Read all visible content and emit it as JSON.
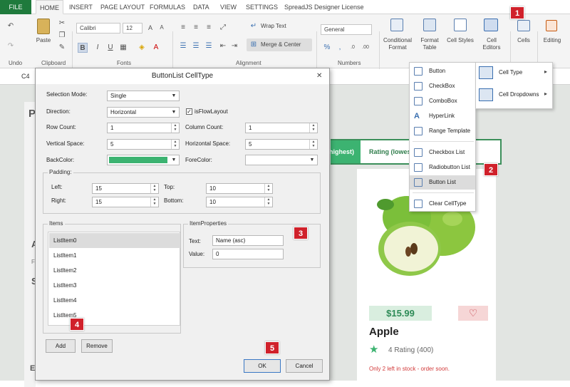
{
  "tabs": [
    "FILE",
    "HOME",
    "INSERT",
    "PAGE LAYOUT",
    "FORMULAS",
    "DATA",
    "VIEW",
    "SETTINGS",
    "SpreadJS Designer License"
  ],
  "ribbon": {
    "groups": {
      "undo": "Undo",
      "clipboard": "Clipboard",
      "fonts": "Fonts",
      "alignment": "Alignment",
      "numbers": "Numbers"
    },
    "paste": "Paste",
    "font_name": "Calibri",
    "font_size": "12",
    "wrap_text": "Wrap Text",
    "merge_center": "Merge & Center",
    "number_format": "General",
    "conditional_format": [
      "Conditional",
      "Format"
    ],
    "format_table": [
      "Format",
      "Table"
    ],
    "cell_styles": "Cell Styles",
    "cell_editors": [
      "Cell",
      "Editors"
    ],
    "cells": "Cells",
    "editing": "Editing",
    "bold": "B",
    "italic": "I",
    "underline": "U"
  },
  "formula_bar": {
    "cell_ref": "C4"
  },
  "sheet": {
    "p_letter": "P",
    "a_letter": "A",
    "f_letter": "F",
    "s_letter": "S",
    "e_letter": "E",
    "header_highest": "highest)",
    "header_rating_lowest": "Rating (lowes",
    "price": "$15.99",
    "product_name": "Apple",
    "rating": "4 Rating (400)",
    "stock": "Only 2 left in stock - order soon.",
    "star": "★",
    "heart": "♡"
  },
  "dialog": {
    "title": "ButtonList CellType",
    "close": "✕",
    "selection_mode_label": "Selection Mode:",
    "selection_mode": "Single",
    "direction_label": "Direction:",
    "direction": "Horizontal",
    "is_flow_layout": "isFlowLayout",
    "row_count_label": "Row Count:",
    "row_count": "1",
    "column_count_label": "Column Count:",
    "column_count": "1",
    "vertical_space_label": "Vertical Space:",
    "vertical_space": "5",
    "horizontal_space_label": "Horizontal Space:",
    "horizontal_space": "5",
    "back_color_label": "BackColor:",
    "back_color": "#3cb371",
    "fore_color_label": "ForeColor:",
    "padding_label": "Padding:",
    "left_label": "Left:",
    "left": "15",
    "top_label": "Top:",
    "top": "10",
    "right_label": "Right:",
    "right": "15",
    "bottom_label": "Bottom:",
    "bottom": "10",
    "items_label": "Items",
    "items": [
      "ListItem0",
      "ListItem1",
      "ListItem2",
      "ListItem3",
      "ListItem4",
      "ListItem5"
    ],
    "item_properties_label": "ItemProperties",
    "text_label": "Text:",
    "text_value": "Name (asc)",
    "value_label": "Value:",
    "value_value": "0",
    "add": "Add",
    "remove": "Remove",
    "ok": "OK",
    "cancel": "Cancel"
  },
  "cell_editors_menu": {
    "items": [
      "Button",
      "CheckBox",
      "ComboBox",
      "HyperLink",
      "Range Template",
      "Checkbox List",
      "Radiobutton List",
      "Button List",
      "Clear CellType"
    ],
    "highlighted": "Button List"
  },
  "cell_type_menu": {
    "items": [
      "Cell Type",
      "Cell Dropdowns"
    ],
    "arrow": "▸"
  },
  "badges": [
    "1",
    "2",
    "3",
    "4",
    "5"
  ],
  "colors": {
    "accent": "#1f7a3c",
    "badge": "#d0212b",
    "price_bg": "#d9eedf",
    "heart_bg": "#f6d6d6"
  }
}
